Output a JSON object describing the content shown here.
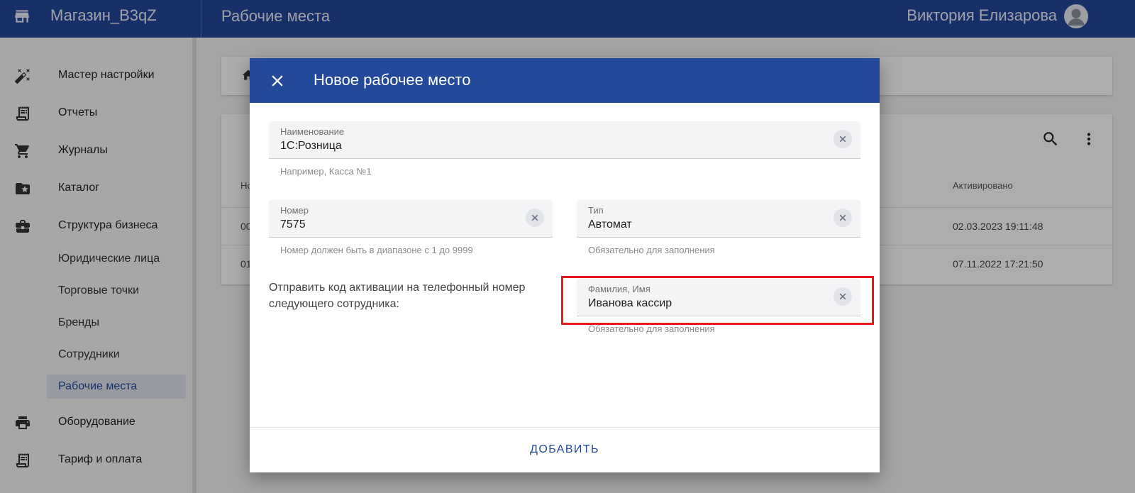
{
  "app": {
    "store_name": "Магазин_B3qZ",
    "page_title": "Рабочие места",
    "user_name": "Виктория Елизарова"
  },
  "sidebar": {
    "items": [
      {
        "label": "Мастер настройки",
        "icon": "magic-wand-icon"
      },
      {
        "label": "Отчеты",
        "icon": "receipt-icon"
      },
      {
        "label": "Журналы",
        "icon": "cart-icon"
      },
      {
        "label": "Каталог",
        "icon": "folder-star-icon"
      },
      {
        "label": "Структура бизнеса",
        "icon": "briefcase-icon"
      }
    ],
    "sub_items": [
      {
        "label": "Юридические лица"
      },
      {
        "label": "Торговые точки"
      },
      {
        "label": "Бренды"
      },
      {
        "label": "Сотрудники"
      },
      {
        "label": "Рабочие места",
        "active": true
      }
    ],
    "bottom_items": [
      {
        "label": "Оборудование",
        "icon": "printer-icon"
      },
      {
        "label": "Тариф и оплата",
        "icon": "receipt-icon"
      }
    ]
  },
  "background_table": {
    "header_first": "Но",
    "header_activated": "Активировано",
    "rows": [
      {
        "number": "00",
        "activated": "02.03.2023 19:11:48"
      },
      {
        "number": "01",
        "activated": "07.11.2022 17:21:50"
      }
    ]
  },
  "dialog": {
    "title": "Новое рабочее место",
    "name_field": {
      "label": "Наименование",
      "value": "1С:Розница",
      "hint": "Например, Касса №1"
    },
    "number_field": {
      "label": "Номер",
      "value": "7575",
      "hint": "Номер должен быть в диапазоне с 1 до 9999"
    },
    "type_field": {
      "label": "Тип",
      "value": "Автомат",
      "hint": "Обязательно для заполнения"
    },
    "send_code_text": "Отправить код активации на телефонный номер следующего сотрудника:",
    "employee_field": {
      "label": "Фамилия, Имя",
      "value": "Иванова кассир",
      "hint": "Обязательно для заполнения"
    },
    "add_button": "ДОБАВИТЬ"
  },
  "colors": {
    "primary": "#23499a",
    "highlight": "#e51b1b"
  }
}
